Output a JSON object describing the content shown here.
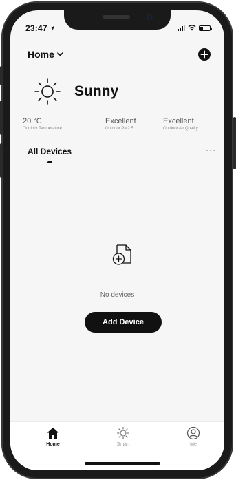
{
  "status_bar": {
    "time": "23:47"
  },
  "header": {
    "home_label": "Home"
  },
  "weather": {
    "condition": "Sunny",
    "stats": [
      {
        "value": "20 °C",
        "label": "Outdoor Temperature"
      },
      {
        "value": "Excellent",
        "label": "Outdoor PM2.5"
      },
      {
        "value": "Excellent",
        "label": "Outdoor Air Quality"
      }
    ]
  },
  "devices": {
    "title": "All Devices",
    "more": "···",
    "empty_text": "No devices",
    "add_button": "Add Device"
  },
  "tabs": [
    {
      "label": "Home",
      "icon": "home-icon",
      "active": true
    },
    {
      "label": "Smart",
      "icon": "sun-icon",
      "active": false
    },
    {
      "label": "Me",
      "icon": "user-icon",
      "active": false
    }
  ],
  "colors": {
    "accent": "#111111",
    "background": "#f6f6f6"
  }
}
